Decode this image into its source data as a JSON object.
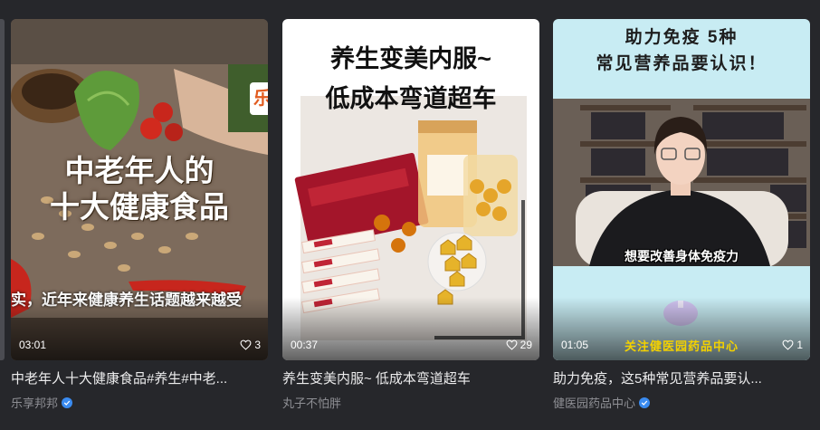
{
  "cards": [
    {
      "duration": "03:01",
      "likes": "3",
      "title": "中老年人十大健康食品#养生#中老...",
      "author": "乐享邦邦",
      "verified": true,
      "thumb": {
        "headline_line1": "中老年人的",
        "headline_line2": "十大健康食品",
        "subtitle": "实，近年来健康养生话题越来越受",
        "side_tag": "乐"
      }
    },
    {
      "duration": "00:37",
      "likes": "29",
      "title": "养生变美内服~ 低成本弯道超车",
      "author": "丸子不怕胖",
      "verified": false,
      "thumb": {
        "headline_line1": "养生变美内服~",
        "headline_line2": "低成本弯道超车"
      }
    },
    {
      "duration": "01:05",
      "likes": "1",
      "title": "助力免疫，这5种常见营养品要认...",
      "author": "健医园药品中心",
      "verified": true,
      "thumb": {
        "headline_line1": "助力免疫 5种",
        "headline_line2": "常见营养品要认识！",
        "caption": "想要改善身体免疫力",
        "footer": "关注健医园药品中心"
      }
    }
  ],
  "colors": {
    "background": "#26272b",
    "verified_badge": "#3a8bf0",
    "author_text": "#8e8f94"
  }
}
